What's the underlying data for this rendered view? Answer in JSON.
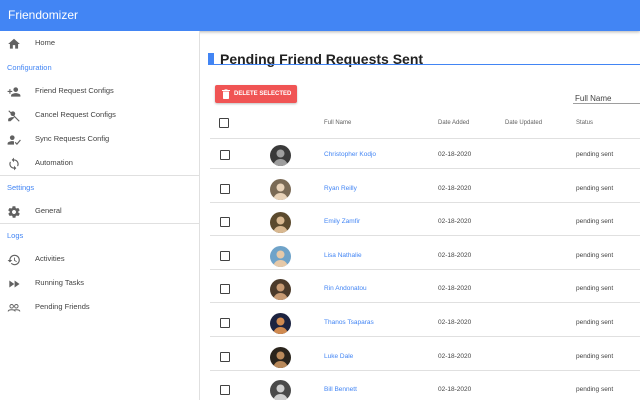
{
  "app": {
    "title": "Friendomizer"
  },
  "sidebar": {
    "home": {
      "label": "Home",
      "icon": "home-icon"
    },
    "sections": {
      "configuration": "Configuration",
      "settings": "Settings",
      "logs": "Logs"
    },
    "config_items": [
      {
        "label": "Friend Request Configs",
        "icon": "person-add-icon"
      },
      {
        "label": "Cancel Request Configs",
        "icon": "person-cancel-icon"
      },
      {
        "label": "Sync Requests Config",
        "icon": "person-sync-icon"
      },
      {
        "label": "Automation",
        "icon": "sync-icon"
      }
    ],
    "settings_items": [
      {
        "label": "General",
        "icon": "gear-icon"
      }
    ],
    "log_items": [
      {
        "label": "Activities",
        "icon": "history-icon"
      },
      {
        "label": "Running Tasks",
        "icon": "fast-forward-icon"
      },
      {
        "label": "Pending Friends",
        "icon": "people-icon"
      }
    ]
  },
  "main": {
    "title": "Pending Friend Requests Sent",
    "delete_button": "DELETE SELECTED",
    "filter_placeholder": "Full Name",
    "columns": {
      "full_name": "Full Name",
      "date_added": "Date Added",
      "date_updated": "Date Updated",
      "status": "Status"
    },
    "rows": [
      {
        "name": "Christopher Kodjo",
        "date_added": "02-18-2020",
        "date_updated": "",
        "status": "pending sent"
      },
      {
        "name": "Ryan Reilly",
        "date_added": "02-18-2020",
        "date_updated": "",
        "status": "pending sent"
      },
      {
        "name": "Emily Zamfir",
        "date_added": "02-18-2020",
        "date_updated": "",
        "status": "pending sent"
      },
      {
        "name": "Lisa Nathalie",
        "date_added": "02-18-2020",
        "date_updated": "",
        "status": "pending sent"
      },
      {
        "name": "Rin Andonatou",
        "date_added": "02-18-2020",
        "date_updated": "",
        "status": "pending sent"
      },
      {
        "name": "Thanos Tsaparas",
        "date_added": "02-18-2020",
        "date_updated": "",
        "status": "pending sent"
      },
      {
        "name": "Luke Dale",
        "date_added": "02-18-2020",
        "date_updated": "",
        "status": "pending sent"
      },
      {
        "name": "Bill Bennett",
        "date_added": "02-18-2020",
        "date_updated": "",
        "status": "pending sent"
      }
    ]
  },
  "colors": {
    "primary": "#4285f4",
    "danger": "#f05454"
  }
}
